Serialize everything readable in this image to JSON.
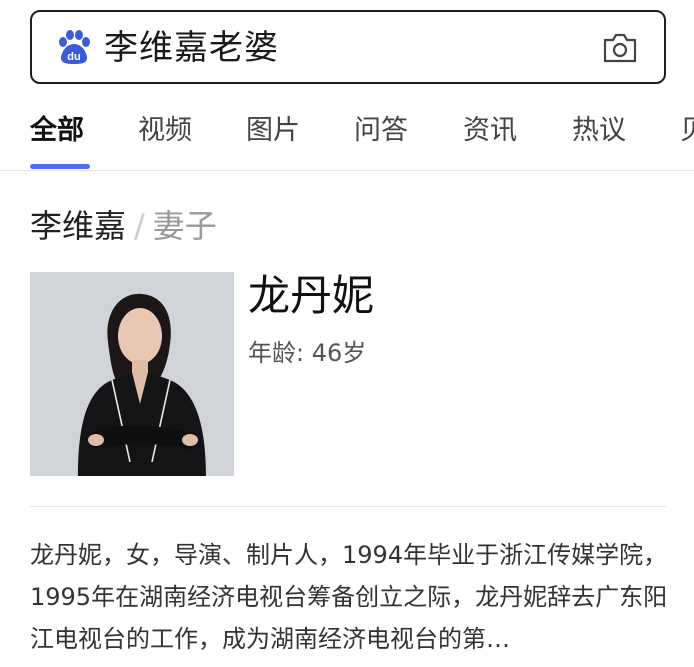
{
  "search": {
    "query": "李维嘉老婆",
    "logo_icon": "baidu-paw-icon",
    "camera_icon": "camera-icon"
  },
  "tabs": [
    {
      "label": "全部",
      "active": true
    },
    {
      "label": "视频",
      "active": false
    },
    {
      "label": "图片",
      "active": false
    },
    {
      "label": "问答",
      "active": false
    },
    {
      "label": "资讯",
      "active": false
    },
    {
      "label": "热议",
      "active": false
    },
    {
      "label": "贝",
      "active": false
    }
  ],
  "card": {
    "breadcrumb_main": "李维嘉",
    "breadcrumb_sep": "/",
    "breadcrumb_sub": "妻子",
    "name": "龙丹妮",
    "age_label": "年龄:",
    "age_value": "46岁",
    "description": "龙丹妮，女，导演、制片人，1994年毕业于浙江传媒学院，1995年在湖南经济电视台筹备创立之际，龙丹妮辞去广东阳江电视台的工作，成为湖南经济电视台的第…"
  },
  "colors": {
    "accent": "#4e6ef2",
    "logo": "#3b5bdb"
  }
}
